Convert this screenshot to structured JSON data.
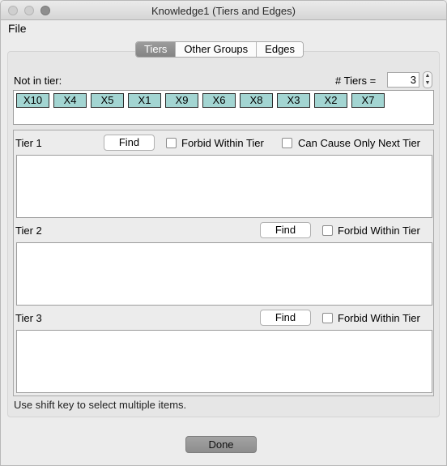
{
  "window": {
    "title": "Knowledge1 (Tiers and Edges)"
  },
  "menu": {
    "file": "File"
  },
  "tabs": [
    {
      "label": "Tiers",
      "active": true
    },
    {
      "label": "Other Groups",
      "active": false
    },
    {
      "label": "Edges",
      "active": false
    }
  ],
  "not_in_tier": {
    "label": "Not in tier:",
    "items": [
      "X10",
      "X4",
      "X5",
      "X1",
      "X9",
      "X6",
      "X8",
      "X3",
      "X2",
      "X7"
    ]
  },
  "num_tiers": {
    "label": "# Tiers =",
    "value": "3"
  },
  "tiers": [
    {
      "label": "Tier 1",
      "find": "Find",
      "forbid": "Forbid Within Tier",
      "next_only": "Can Cause Only Next Tier",
      "forbid_checked": false,
      "next_only_checked": false
    },
    {
      "label": "Tier 2",
      "find": "Find",
      "forbid": "Forbid Within Tier",
      "forbid_checked": false
    },
    {
      "label": "Tier 3",
      "find": "Find",
      "forbid": "Forbid Within Tier",
      "forbid_checked": false
    }
  ],
  "hint": "Use shift key to select multiple items.",
  "done": "Done",
  "colors": {
    "chip": "#a3d5d2",
    "active_tab": "#8e8e8e"
  }
}
